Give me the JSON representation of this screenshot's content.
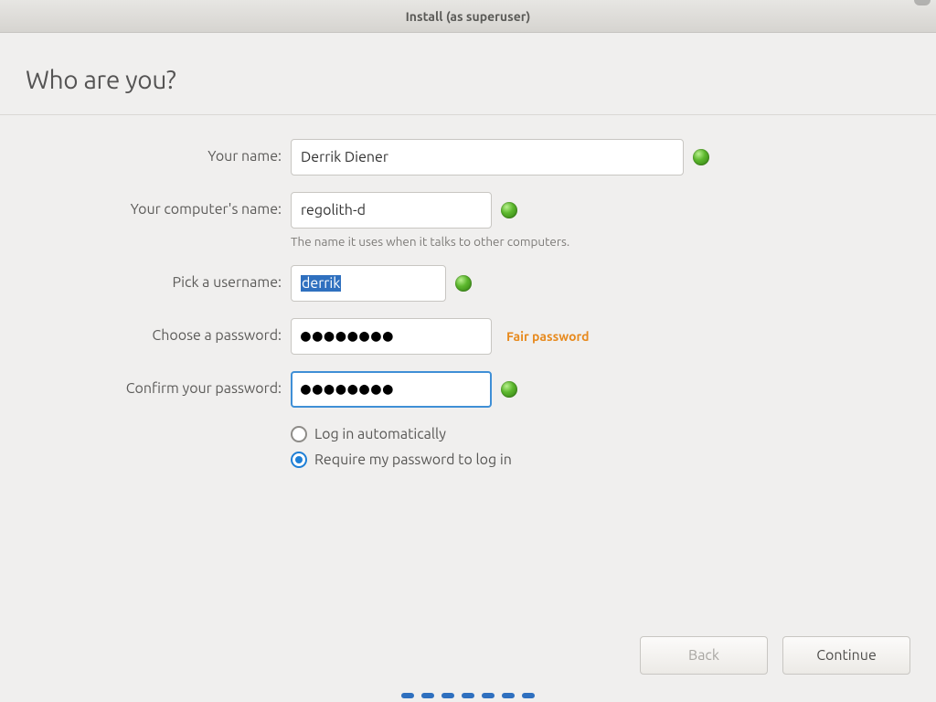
{
  "window": {
    "title": "Install (as superuser)"
  },
  "page": {
    "title": "Who are you?"
  },
  "labels": {
    "name": "Your name:",
    "hostname": "Your computer's name:",
    "hostname_hint": "The name it uses when it talks to other computers.",
    "username": "Pick a username:",
    "password": "Choose a password:",
    "confirm": "Confirm your password:"
  },
  "fields": {
    "name": "Derrik Diener",
    "hostname": "regolith-d",
    "username": "derrik",
    "password_mask": "●●●●●●●●",
    "confirm_mask": "●●●●●●●●",
    "password_strength": "Fair password"
  },
  "login_options": {
    "auto": "Log in automatically",
    "require": "Require my password to log in",
    "selected": "require"
  },
  "buttons": {
    "back": "Back",
    "continue": "Continue"
  },
  "progress": {
    "steps": 7
  }
}
